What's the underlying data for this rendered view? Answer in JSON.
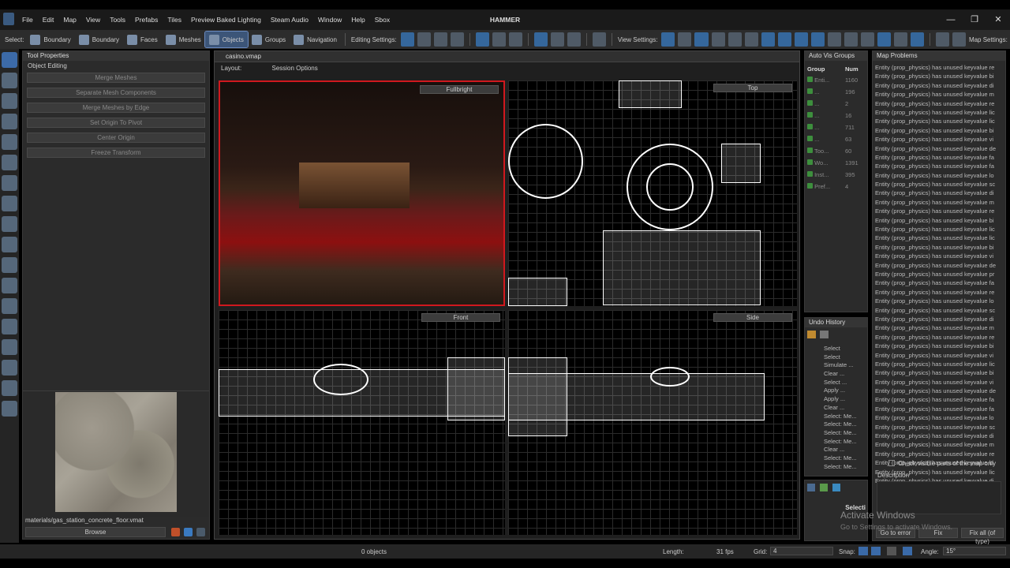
{
  "app": {
    "title": "HAMMER"
  },
  "menu": [
    "File",
    "Edit",
    "Map",
    "View",
    "Tools",
    "Prefabs",
    "Tiles",
    "Preview Baked Lighting",
    "Steam Audio",
    "Window",
    "Help",
    "Sbox"
  ],
  "window_controls": {
    "minimize": "—",
    "maximize": "❐",
    "close": "✕"
  },
  "toolbar": {
    "select_label": "Select:",
    "modes": [
      "Boundary",
      "Boundary",
      "Faces",
      "Meshes",
      "Objects",
      "Groups",
      "Navigation"
    ],
    "active_mode": "Objects",
    "editing_settings_label": "Editing Settings:",
    "view_settings_label": "View Settings:",
    "map_settings_label": "Map Settings:",
    "accent": "#3c6aa8"
  },
  "tool_properties": {
    "tab": "Tool Properties",
    "section": "Object Editing",
    "buttons": [
      "Merge Meshes",
      "Separate Mesh Components",
      "Merge Meshes by Edge",
      "Set Origin To Pivot",
      "Center Origin",
      "Freeze Transform"
    ],
    "material_name": "materials/gas_station_concrete_floor.vmat",
    "browse_label": "Browse"
  },
  "document": {
    "tab": "casino.vmap",
    "layout_label": "Layout:",
    "session_label": "Session Options"
  },
  "viewports": {
    "perspective": "Fullbright",
    "top": "Top",
    "front": "Front",
    "side": "Side"
  },
  "auto_vis": {
    "title": "Auto Vis Groups",
    "col_group": "Group",
    "col_num": "Num",
    "rows": [
      {
        "name": "Enti...",
        "num": "1160"
      },
      {
        "name": "...",
        "num": "196"
      },
      {
        "name": "...",
        "num": "2"
      },
      {
        "name": "...",
        "num": "16"
      },
      {
        "name": "...",
        "num": "711"
      },
      {
        "name": "...",
        "num": "63"
      },
      {
        "name": "Too...",
        "num": "60"
      },
      {
        "name": "Wo...",
        "num": "1391"
      },
      {
        "name": "Inst...",
        "num": "395"
      },
      {
        "name": "Pref...",
        "num": "4"
      }
    ]
  },
  "undo_history": {
    "title": "Undo History",
    "items": [
      "Select",
      "Select",
      "Simulate ...",
      "Clear ...",
      "Select ...",
      "Apply ...",
      "Apply ...",
      "Clear ...",
      "Select: Me...",
      "Select: Me...",
      "Select: Me...",
      "Select: Me...",
      "Clear ...",
      "Select: Me...",
      "Select: Me..."
    ]
  },
  "selection_panel": {
    "title": "Selecti"
  },
  "map_problems": {
    "title": "Map Problems",
    "items": [
      "Entity (prop_physics) has unused keyvalue re",
      "Entity (prop_physics) has unused keyvalue bi",
      "Entity (prop_physics) has unused keyvalue di",
      "Entity (prop_physics) has unused keyvalue m",
      "Entity (prop_physics) has unused keyvalue re",
      "Entity (prop_physics) has unused keyvalue lic",
      "Entity (prop_physics) has unused keyvalue lic",
      "Entity (prop_physics) has unused keyvalue bi",
      "Entity (prop_physics) has unused keyvalue vi",
      "Entity (prop_physics) has unused keyvalue de",
      "Entity (prop_physics) has unused keyvalue fa",
      "Entity (prop_physics) has unused keyvalue fa",
      "Entity (prop_physics) has unused keyvalue lo",
      "Entity (prop_physics) has unused keyvalue sc",
      "Entity (prop_physics) has unused keyvalue di",
      "Entity (prop_physics) has unused keyvalue m",
      "Entity (prop_physics) has unused keyvalue re",
      "Entity (prop_physics) has unused keyvalue bi",
      "Entity (prop_physics) has unused keyvalue lic",
      "Entity (prop_physics) has unused keyvalue lic",
      "Entity (prop_physics) has unused keyvalue bi",
      "Entity (prop_physics) has unused keyvalue vi",
      "Entity (prop_physics) has unused keyvalue de",
      "Entity (prop_physics) has unused keyvalue pr",
      "Entity (prop_physics) has unused keyvalue fa",
      "Entity (prop_physics) has unused keyvalue re",
      "Entity (prop_physics) has unused keyvalue lo",
      "Entity (prop_physics) has unused keyvalue sc",
      "Entity (prop_physics) has unused keyvalue di",
      "Entity (prop_physics) has unused keyvalue m",
      "Entity (prop_physics) has unused keyvalue re",
      "Entity (prop_physics) has unused keyvalue bi",
      "Entity (prop_physics) has unused keyvalue vi",
      "Entity (prop_physics) has unused keyvalue lic",
      "Entity (prop_physics) has unused keyvalue bi",
      "Entity (prop_physics) has unused keyvalue vi",
      "Entity (prop_physics) has unused keyvalue de",
      "Entity (prop_physics) has unused keyvalue fa",
      "Entity (prop_physics) has unused keyvalue fa",
      "Entity (prop_physics) has unused keyvalue lo",
      "Entity (prop_physics) has unused keyvalue sc",
      "Entity (prop_physics) has unused keyvalue di",
      "Entity (prop_physics) has unused keyvalue m",
      "Entity (prop_physics) has unused keyvalue re",
      "Entity (prop_physics) has unused keyvalue bi",
      "Entity (prop_physics) has unused keyvalue lic",
      "Entity (prop_physics) has unused keyvalue di"
    ],
    "check_visible": "Check visible parts of the map only",
    "description_label": "Description",
    "go_to_error": "Go to error",
    "fix": "Fix",
    "fix_all": "Fix all (of type)"
  },
  "watermark": {
    "line1": "Activate Windows",
    "line2": "Go to Settings to activate Windows."
  },
  "status": {
    "objects": "0 objects",
    "length_label": "Length:",
    "fps": "31 fps",
    "grid_label": "Grid:",
    "grid_value": "4",
    "snap_label": "Snap:",
    "angle_label": "Angle:",
    "angle_value": "15°"
  }
}
